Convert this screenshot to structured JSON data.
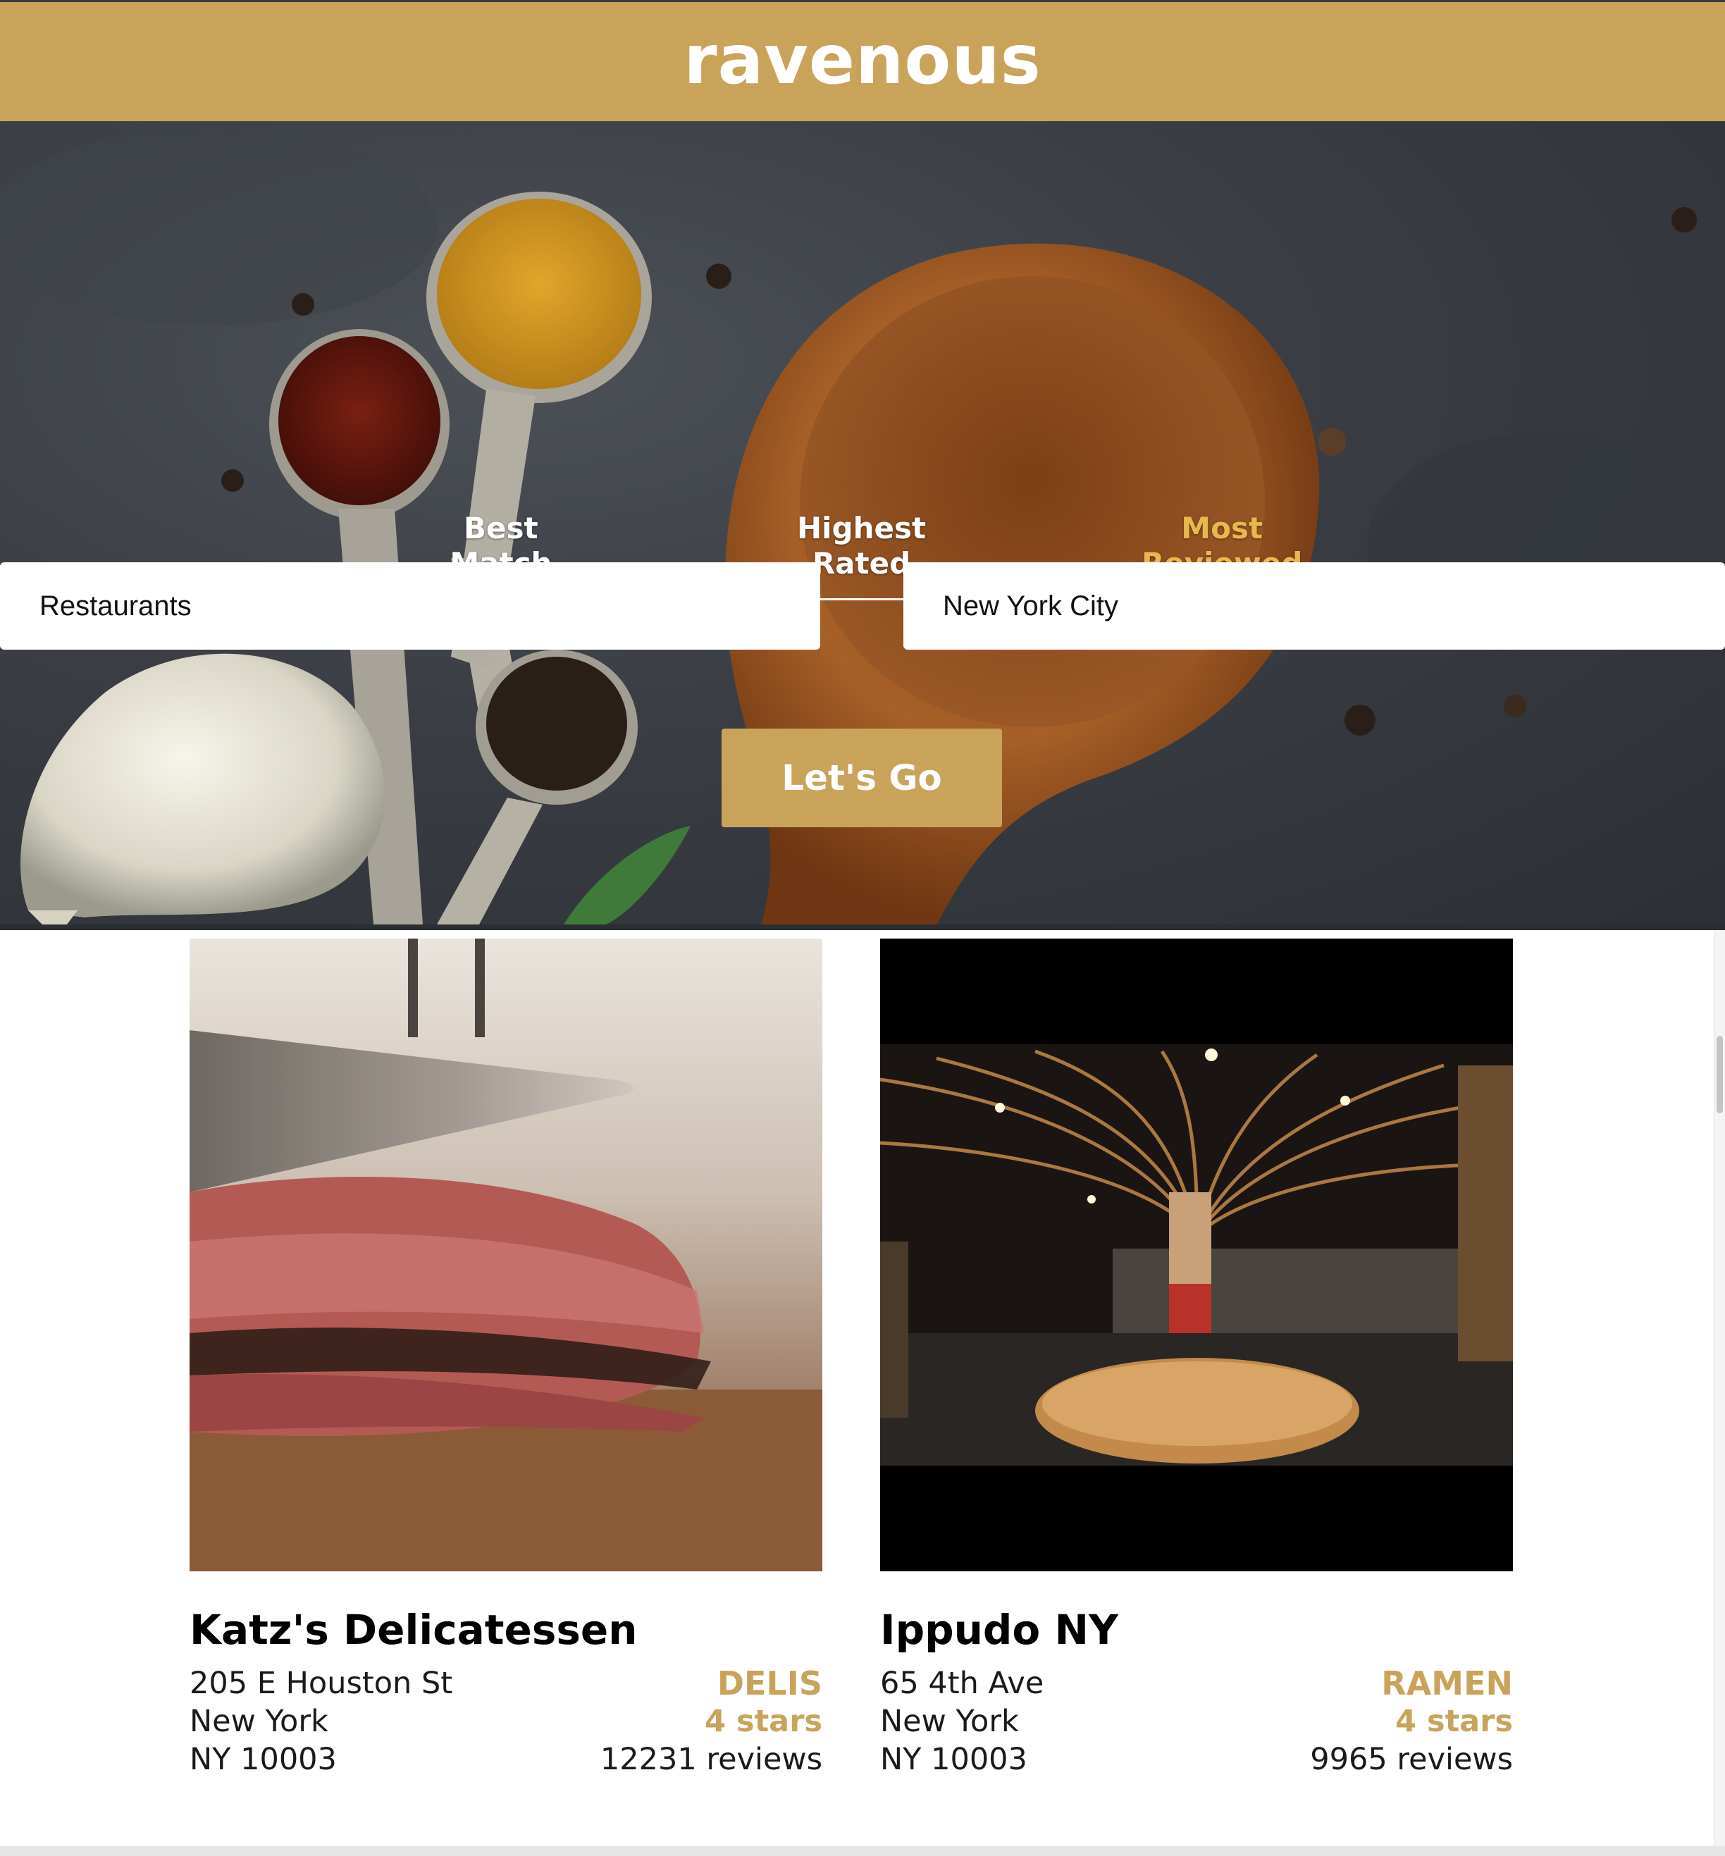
{
  "header": {
    "logo": "ravenous"
  },
  "sort_options": [
    {
      "label": "Best\nMatch",
      "active": false
    },
    {
      "label": "Highest\nRated",
      "active": false
    },
    {
      "label": "Most\nReviewed",
      "active": true
    }
  ],
  "search": {
    "terms_value": "Restaurants",
    "location_value": "New York City",
    "submit_label": "Let's Go"
  },
  "businesses": [
    {
      "name": "Katz's Delicatessen",
      "address": "205 E Houston St",
      "city": "New York",
      "state_zip": "NY 10003",
      "category": "DELIS",
      "rating": "4 stars",
      "reviews": "12231 reviews"
    },
    {
      "name": "Ippudo NY",
      "address": "65 4th Ave",
      "city": "New York",
      "state_zip": "NY 10003",
      "category": "RAMEN",
      "rating": "4 stars",
      "reviews": "9965 reviews"
    }
  ],
  "colors": {
    "brand_gold": "#caa35b",
    "active_tab": "#e8b84f"
  }
}
